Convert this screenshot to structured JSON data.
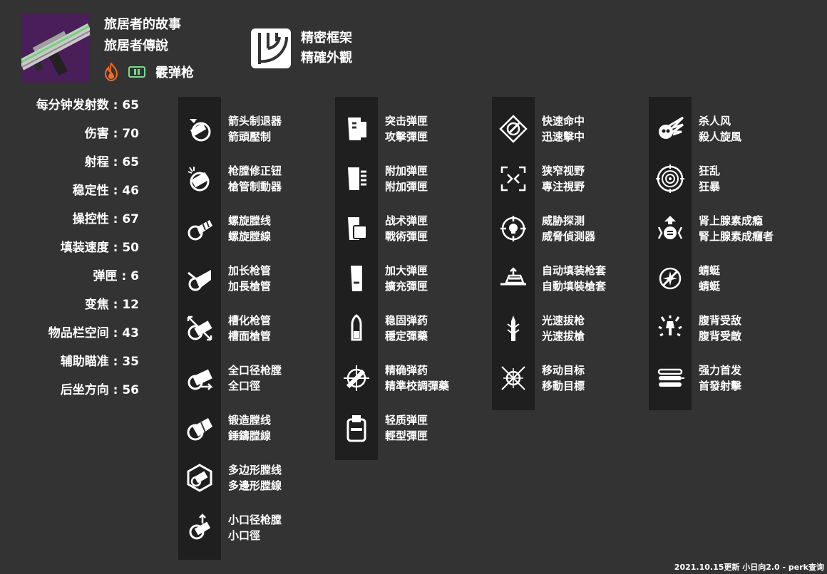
{
  "weapon": {
    "name_sc": "旅居者的故事",
    "name_tc": "旅居者傳說",
    "type": "霰弹枪",
    "element_icon": "solar-flame-icon",
    "ammo_icon": "special-ammo-icon",
    "colors": {
      "solar": "#f26b21",
      "special_ammo": "#7ad98a",
      "image_tint": "#6a2a7a"
    }
  },
  "frame": {
    "icon": "precision-frame-icon",
    "name_sc": "精密框架",
    "name_tc": "精確外觀"
  },
  "stats": [
    "每分钟发射数 : 65",
    "伤害 : 70",
    "射程 : 65",
    "稳定性 : 46",
    "操控性 : 67",
    "填装速度 : 50",
    "弹匣 : 6",
    "变焦 : 12",
    "物品栏空间 : 43",
    "辅助瞄准 : 35",
    "后坐方向 : 56"
  ],
  "columns": [
    {
      "perks": [
        {
          "icon": "arrowhead-brake-icon",
          "sc": "箭头制退器",
          "tc": "箭頭壓制"
        },
        {
          "icon": "barrel-compensator-icon",
          "sc": "枪膛修正钮",
          "tc": "槍管制動器"
        },
        {
          "icon": "corkscrew-rifling-icon",
          "sc": "螺旋膛线",
          "tc": "螺旋膛線"
        },
        {
          "icon": "extended-barrel-icon",
          "sc": "加长枪管",
          "tc": "加長槍管"
        },
        {
          "icon": "fluted-barrel-icon",
          "sc": "槽化枪管",
          "tc": "槽面槍管"
        },
        {
          "icon": "full-bore-icon",
          "sc": "全口径枪膛",
          "tc": "全口徑"
        },
        {
          "icon": "hammer-forged-rifling-icon",
          "sc": "锻造膛线",
          "tc": "錘鑄膛線"
        },
        {
          "icon": "polygonal-rifling-icon",
          "sc": "多边形膛线",
          "tc": "多邊形膛線"
        },
        {
          "icon": "smallbore-icon",
          "sc": "小口径枪膛",
          "tc": "小口徑"
        }
      ]
    },
    {
      "perks": [
        {
          "icon": "assault-mag-icon",
          "sc": "突击弹匣",
          "tc": "攻擊彈匣"
        },
        {
          "icon": "appended-mag-icon",
          "sc": "附加弹匣",
          "tc": "附加彈匣"
        },
        {
          "icon": "tactical-mag-icon",
          "sc": "战术弹匣",
          "tc": "戰術彈匣"
        },
        {
          "icon": "extended-mag-icon",
          "sc": "加大弹匣",
          "tc": "擴充彈匣"
        },
        {
          "icon": "steady-rounds-icon",
          "sc": "稳固弹药",
          "tc": "穩定彈藥"
        },
        {
          "icon": "accurized-rounds-icon",
          "sc": "精确弹药",
          "tc": "精準校調彈藥"
        },
        {
          "icon": "light-mag-icon",
          "sc": "轻质弹匣",
          "tc": "輕型彈匣"
        }
      ]
    },
    {
      "perks": [
        {
          "icon": "quickdraw-hit-icon",
          "sc": "快速命中",
          "tc": "迅速擊中"
        },
        {
          "icon": "tunnel-vision-icon",
          "sc": "狭窄视野",
          "tc": "專注視野"
        },
        {
          "icon": "threat-detector-icon",
          "sc": "威胁探测",
          "tc": "威脅偵測器"
        },
        {
          "icon": "auto-loading-holster-icon",
          "sc": "自动填装枪套",
          "tc": "自動填裝槍套"
        },
        {
          "icon": "quickdraw-icon",
          "sc": "光速拔枪",
          "tc": "光速拔槍"
        },
        {
          "icon": "moving-target-icon",
          "sc": "移动目标",
          "tc": "移動目標"
        }
      ]
    },
    {
      "perks": [
        {
          "icon": "whirlwind-blade-icon",
          "sc": "杀人风",
          "tc": "殺人旋風"
        },
        {
          "icon": "rampage-icon",
          "sc": "狂乱",
          "tc": "狂暴"
        },
        {
          "icon": "adrenaline-junkie-icon",
          "sc": "肾上腺素成瘾",
          "tc": "腎上腺素成癮者"
        },
        {
          "icon": "dragonfly-icon",
          "sc": "蜻蜓",
          "tc": "蜻蜓"
        },
        {
          "icon": "surrounded-icon",
          "sc": "腹背受敌",
          "tc": "腹背受敵"
        },
        {
          "icon": "opening-shot-icon",
          "sc": "强力首发",
          "tc": "首發射擊"
        }
      ]
    }
  ],
  "footer": "2021.10.15更新 小日向2.0 - perk查询"
}
